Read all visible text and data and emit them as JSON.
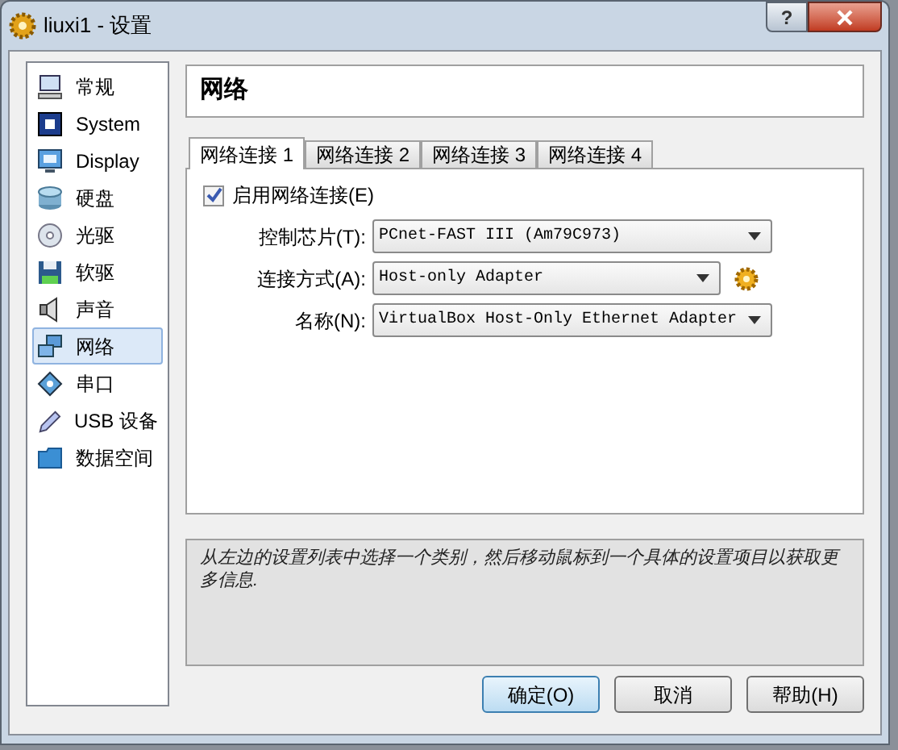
{
  "window": {
    "title": "liuxi1 - 设置",
    "help_button": "?"
  },
  "sidebar": {
    "items": [
      {
        "label": "常规",
        "selected": false
      },
      {
        "label": "System",
        "selected": false
      },
      {
        "label": "Display",
        "selected": false
      },
      {
        "label": "硬盘",
        "selected": false
      },
      {
        "label": "光驱",
        "selected": false
      },
      {
        "label": "软驱",
        "selected": false
      },
      {
        "label": "声音",
        "selected": false
      },
      {
        "label": "网络",
        "selected": true
      },
      {
        "label": "串口",
        "selected": false
      },
      {
        "label": "USB 设备",
        "selected": false
      },
      {
        "label": "数据空间",
        "selected": false
      }
    ]
  },
  "header": "网络",
  "tabs": [
    {
      "label": "网络连接 1",
      "selected": true
    },
    {
      "label": "网络连接 2",
      "selected": false
    },
    {
      "label": "网络连接 3",
      "selected": false
    },
    {
      "label": "网络连接 4",
      "selected": false
    }
  ],
  "enable": {
    "label": "启用网络连接(E)",
    "checked": true
  },
  "fields": [
    {
      "label": "控制芯片(T):",
      "value": "PCnet-FAST III (Am79C973)",
      "gear": false
    },
    {
      "label": "连接方式(A):",
      "value": "Host-only Adapter",
      "gear": true
    },
    {
      "label": "名称(N):",
      "value": "VirtualBox Host-Only Ethernet Adapter",
      "gear": false
    }
  ],
  "info": "从左边的设置列表中选择一个类别，然后移动鼠标到一个具体的设置项目以获取更多信息.",
  "buttons": [
    {
      "label": "确定(O)",
      "default": true
    },
    {
      "label": "取消",
      "default": false
    },
    {
      "label": "帮助(H)",
      "default": false
    }
  ]
}
